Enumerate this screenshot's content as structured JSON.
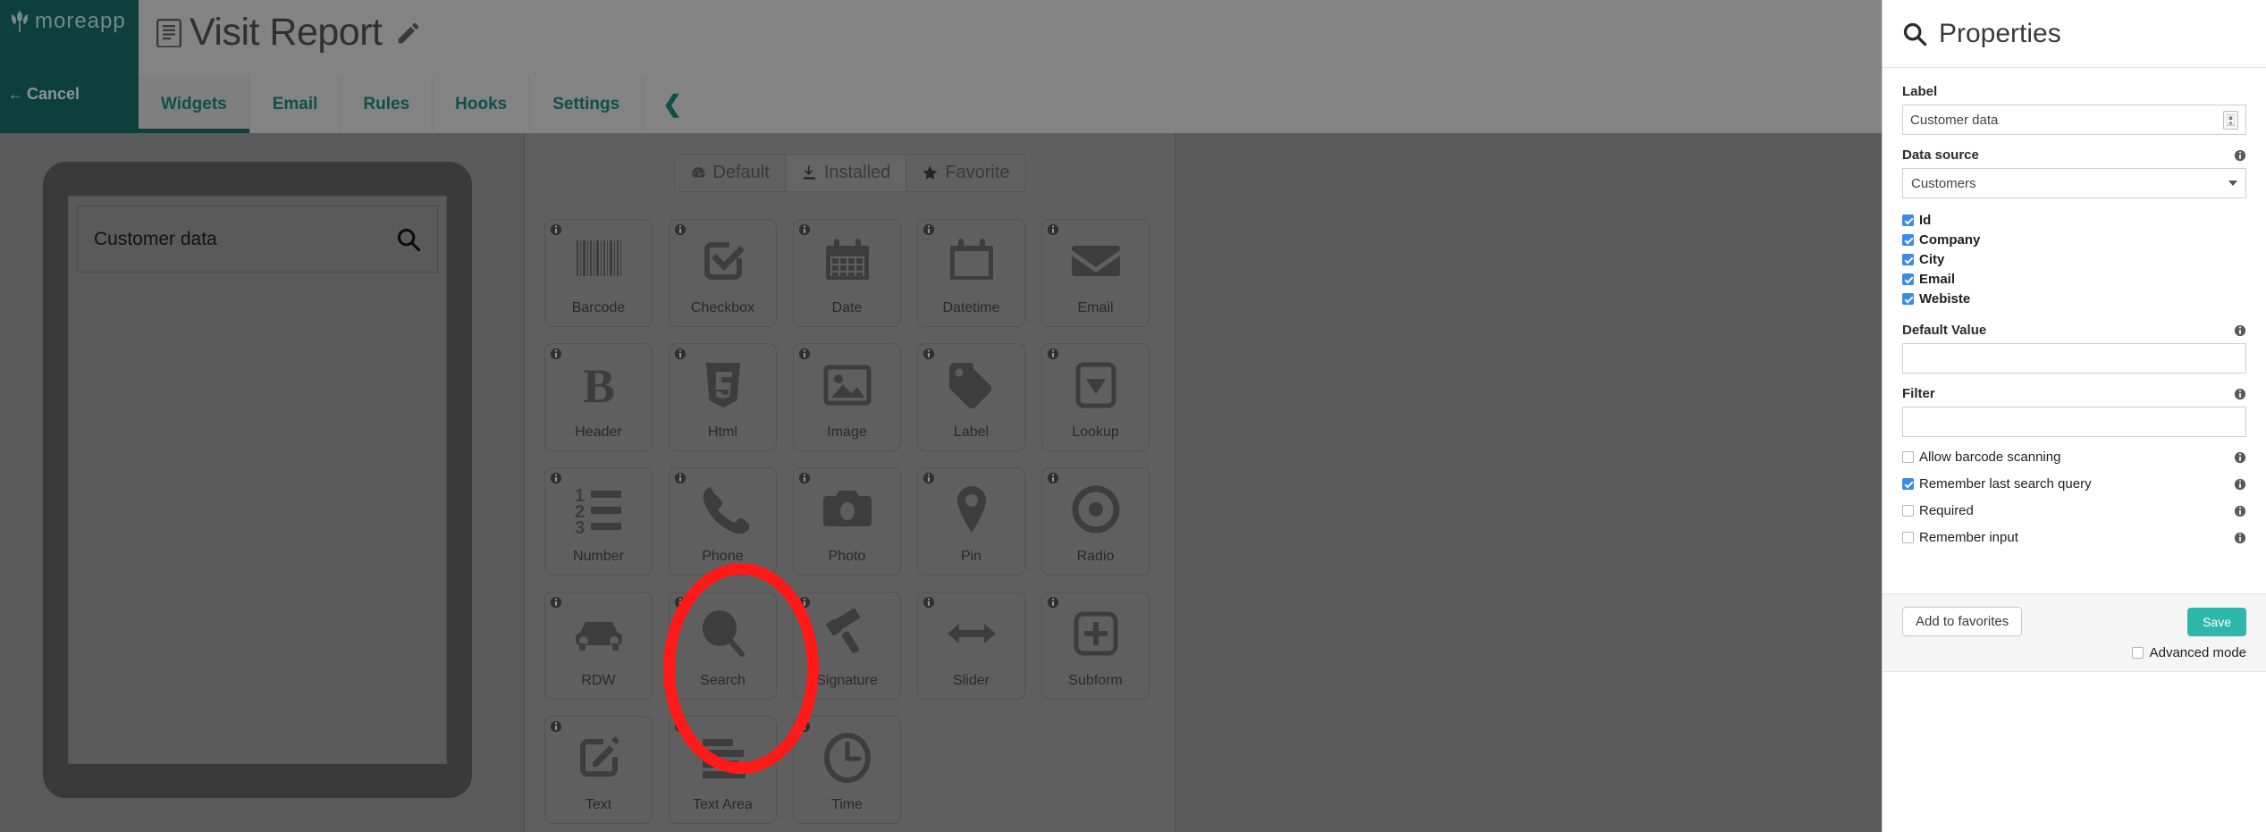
{
  "brand": {
    "name": "moreapp",
    "logo_icon": "moreapp-leaf-icon",
    "cancel_label": "Cancel",
    "cancel_icon": "arrow-left-icon"
  },
  "header": {
    "form_title": "Visit Report",
    "form_icon": "document-icon",
    "edit_icon": "pencil-icon"
  },
  "tabs": [
    {
      "label": "Widgets",
      "active": true,
      "name": "tab-widgets"
    },
    {
      "label": "Email",
      "active": false,
      "name": "tab-email"
    },
    {
      "label": "Rules",
      "active": false,
      "name": "tab-rules"
    },
    {
      "label": "Hooks",
      "active": false,
      "name": "tab-hooks"
    },
    {
      "label": "Settings",
      "active": false,
      "name": "tab-settings"
    }
  ],
  "collapse_icon": "chevron-left-icon",
  "preview": {
    "device": "tablet",
    "widget_label": "Customer data",
    "widget_icon": "search-icon"
  },
  "widget_library": {
    "filters": [
      {
        "label": "Default",
        "icon": "dashboard-icon",
        "active": false
      },
      {
        "label": "Installed",
        "icon": "download-icon",
        "active": true
      },
      {
        "label": "Favorite",
        "icon": "star-icon",
        "active": false
      }
    ],
    "info_icon": "info-icon",
    "widgets": [
      {
        "label": "Barcode",
        "icon": "barcode-icon"
      },
      {
        "label": "Checkbox",
        "icon": "checkbox-icon"
      },
      {
        "label": "Date",
        "icon": "calendar-icon"
      },
      {
        "label": "Datetime",
        "icon": "calendar-blank-icon"
      },
      {
        "label": "Email",
        "icon": "envelope-icon"
      },
      {
        "label": "Header",
        "icon": "bold-b-icon"
      },
      {
        "label": "Html",
        "icon": "html5-icon"
      },
      {
        "label": "Image",
        "icon": "image-icon"
      },
      {
        "label": "Label",
        "icon": "tag-icon"
      },
      {
        "label": "Lookup",
        "icon": "dropdown-icon"
      },
      {
        "label": "Number",
        "icon": "numbered-list-icon"
      },
      {
        "label": "Phone",
        "icon": "phone-icon"
      },
      {
        "label": "Photo",
        "icon": "camera-icon"
      },
      {
        "label": "Pin",
        "icon": "map-pin-icon"
      },
      {
        "label": "Radio",
        "icon": "radio-button-icon"
      },
      {
        "label": "RDW",
        "icon": "car-icon"
      },
      {
        "label": "Search",
        "icon": "magnifier-icon",
        "highlighted": true
      },
      {
        "label": "Signature",
        "icon": "gavel-icon"
      },
      {
        "label": "Slider",
        "icon": "arrows-horizontal-icon"
      },
      {
        "label": "Subform",
        "icon": "plus-square-icon"
      },
      {
        "label": "Text",
        "icon": "pencil-square-icon"
      },
      {
        "label": "Text Area",
        "icon": "lines-icon"
      },
      {
        "label": "Time",
        "icon": "clock-icon"
      }
    ]
  },
  "annotation": {
    "shape": "ellipse",
    "color": "#ff1a1a",
    "targets": "Search"
  },
  "properties": {
    "title": "Properties",
    "title_icon": "search-icon",
    "label_field": {
      "label": "Label",
      "value": "Customer data",
      "placeholder": "",
      "lang_icon": "translate-icon"
    },
    "data_source": {
      "label": "Data source",
      "value": "Customers",
      "info_icon": "info-icon",
      "caret_icon": "chevron-down-icon"
    },
    "fields": [
      {
        "label": "Id",
        "checked": true
      },
      {
        "label": "Company",
        "checked": true
      },
      {
        "label": "City",
        "checked": true
      },
      {
        "label": "Email",
        "checked": true
      },
      {
        "label": "Webiste",
        "checked": true
      }
    ],
    "default_value": {
      "label": "Default Value",
      "value": "",
      "info_icon": "info-icon"
    },
    "filter": {
      "label": "Filter",
      "value": "",
      "info_icon": "info-icon"
    },
    "options": [
      {
        "label": "Allow barcode scanning",
        "checked": false
      },
      {
        "label": "Remember last search query",
        "checked": true
      },
      {
        "label": "Required",
        "checked": false
      },
      {
        "label": "Remember input",
        "checked": false
      }
    ],
    "footer": {
      "add_to_favorites_label": "Add to favorites",
      "save_label": "Save",
      "advanced_mode_label": "Advanced mode",
      "advanced_mode_checked": false
    }
  },
  "colors": {
    "brand_teal": "#14615d",
    "tab_teal": "#1a7a72",
    "save_teal": "#2eb8ad",
    "checkbox_blue": "#3b8ae8",
    "annotation_red": "#ff1a1a"
  }
}
